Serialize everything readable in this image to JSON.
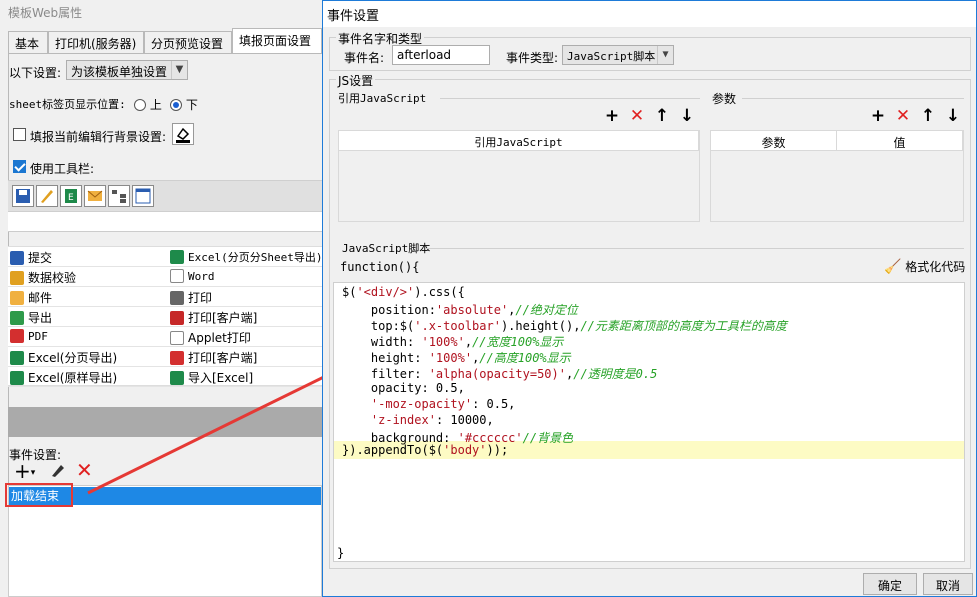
{
  "left": {
    "title": "模板Web属性",
    "tabs": [
      "基本",
      "打印机(服务器)",
      "分页预览设置",
      "填报页面设置"
    ],
    "settings_label": "以下设置:",
    "settings_value": "为该模板单独设置",
    "sheet_label": "sheet标签页显示位置:",
    "sheet_opt_up": "上",
    "sheet_opt_down": "下",
    "fill_row_bg_label": "填报当前编辑行背景设置:",
    "use_toolbar_label": "使用工具栏:",
    "buttons": [
      {
        "left": "提交",
        "right": "Excel(分页分Sheet导出)"
      },
      {
        "left": "数据校验",
        "right": "Word"
      },
      {
        "left": "邮件",
        "right": "打印"
      },
      {
        "left": "导出",
        "right": "打印[客户端]"
      },
      {
        "left": "PDF",
        "right": "Applet打印"
      },
      {
        "left": "Excel(分页导出)",
        "right": "打印[客户端]"
      },
      {
        "left": "Excel(原样导出)",
        "right": "导入[Excel]"
      }
    ],
    "event_settings_label": "事件设置:",
    "event_item": "加载结束"
  },
  "dialog": {
    "title": "事件设置",
    "group_name_type": "事件名字和类型",
    "event_name_label": "事件名:",
    "event_name_value": "afterload",
    "event_type_label": "事件类型:",
    "event_type_value": "JavaScript脚本",
    "group_js": "JS设置",
    "ref_js_label": "引用JavaScript",
    "params_label": "参数",
    "ref_js_col": "引用JavaScript",
    "param_col": "参数",
    "value_col": "值",
    "js_script_label": "JavaScript脚本",
    "func_header": "function(){",
    "format_code": "格式化代码",
    "code_end": "}",
    "ok": "确定",
    "cancel": "取消",
    "code": {
      "l1a": "$(",
      "l1b": "'<div/>'",
      "l1c": ").css({",
      "l2a": "    position:",
      "l2b": "'absolute'",
      "l2c": ",",
      "l2d": "//绝对定位",
      "l3a": "    top:$(",
      "l3b": "'.x-toolbar'",
      "l3c": ").height(),",
      "l3d": "//元素距离顶部的高度为工具栏的高度",
      "l4a": "    width: ",
      "l4b": "'100%'",
      "l4c": ",",
      "l4d": "//宽度100%显示",
      "l5a": "    height: ",
      "l5b": "'100%'",
      "l5c": ",",
      "l5d": "//高度100%显示",
      "l6a": "    filter: ",
      "l6b": "'alpha(opacity=50)'",
      "l6c": ",",
      "l6d": "//透明度是0.5",
      "l7": "    opacity: 0.5,",
      "l8a": "    ",
      "l8b": "'-moz-opacity'",
      "l8c": ": 0.5,",
      "l9a": "    ",
      "l9b": "'z-index'",
      "l9c": ": 10000,",
      "l10a": "    background: ",
      "l10b": "'#cccccc'",
      "l10c": "//背景色",
      "l11a": "}).appendTo($(",
      "l11b": "'body'",
      "l11c": "));"
    }
  },
  "colors": {
    "accent": "#1e88e5",
    "highlight": "#e53935",
    "comment": "#27a227",
    "string": "#b0121f"
  }
}
